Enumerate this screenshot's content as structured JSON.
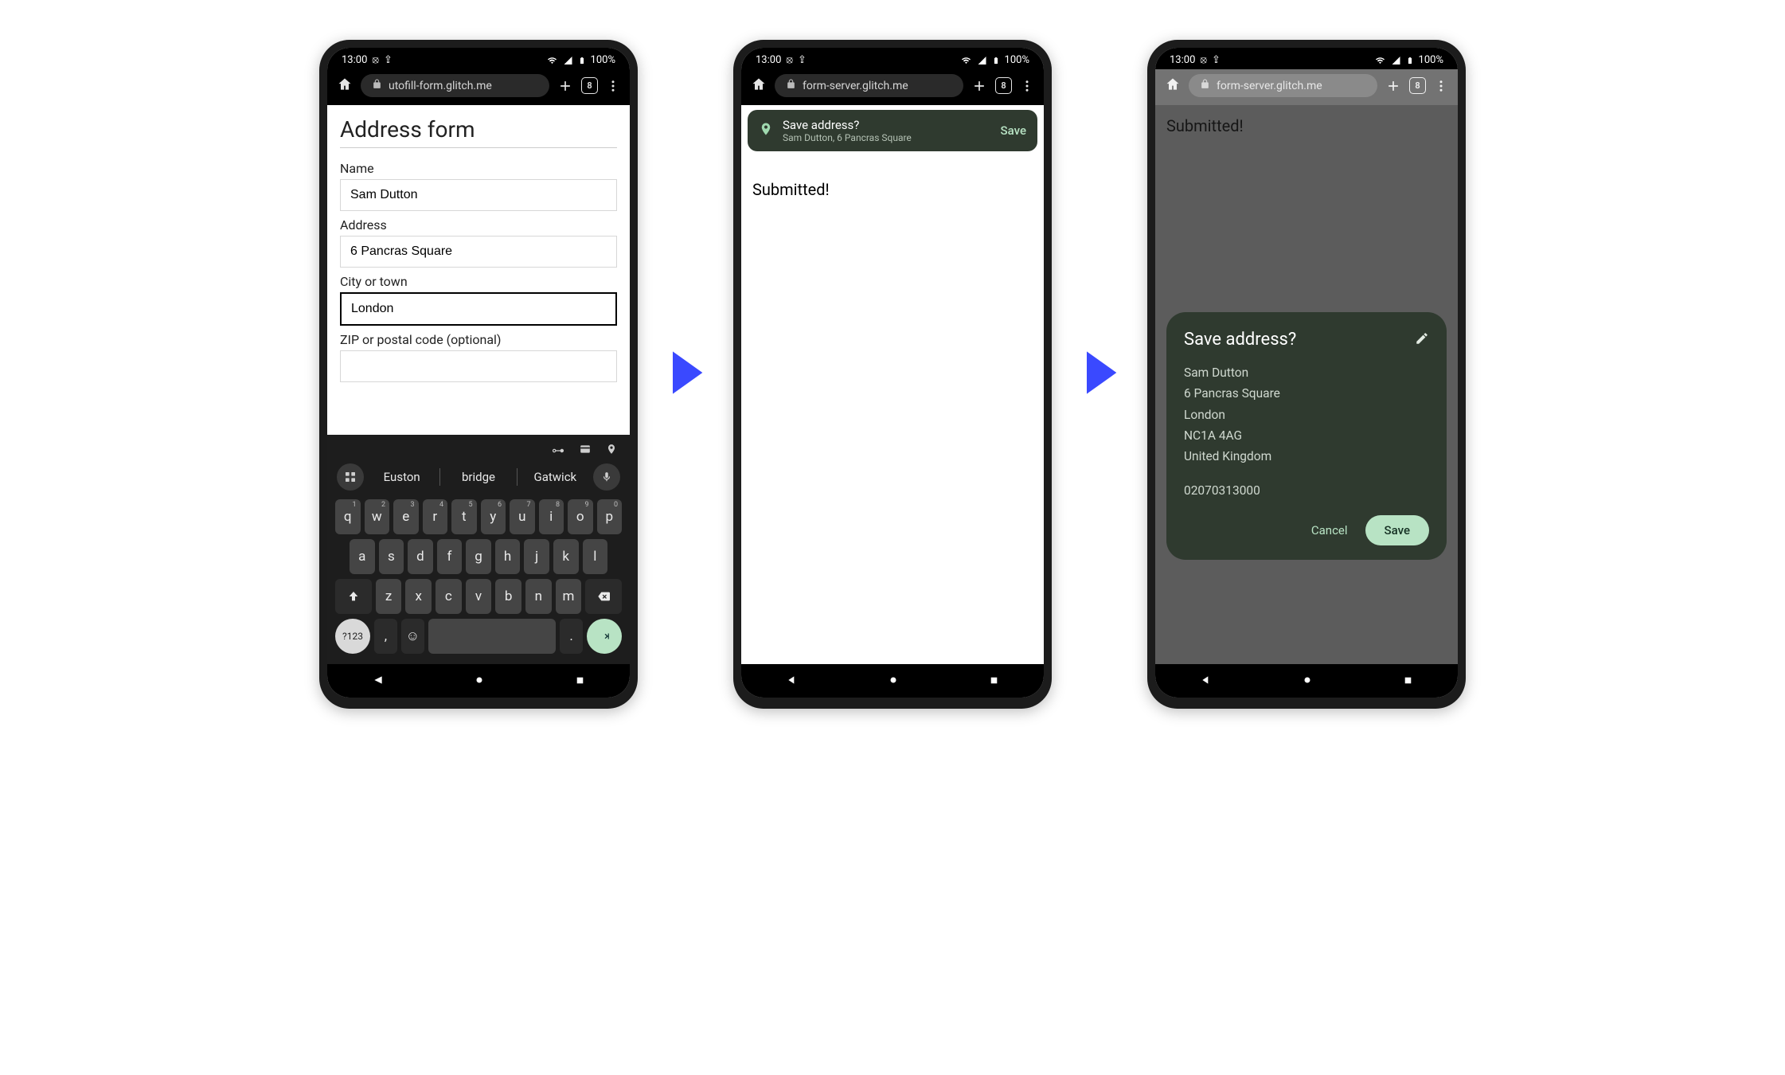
{
  "status": {
    "time": "13:00",
    "battery_text": "100%"
  },
  "omni": {
    "tab_count": "8",
    "urls": {
      "p1": "utofill-form.glitch.me",
      "p2": "form-server.glitch.me",
      "p3": "form-server.glitch.me"
    }
  },
  "form": {
    "heading": "Address form",
    "labels": {
      "name": "Name",
      "address": "Address",
      "city": "City or town",
      "zip": "ZIP or postal code (optional)"
    },
    "values": {
      "name": "Sam Dutton",
      "address": "6 Pancras Square",
      "city": "London"
    }
  },
  "keyboard": {
    "suggestions": [
      "Euston",
      "bridge",
      "Gatwick"
    ],
    "row1": [
      "q",
      "w",
      "e",
      "r",
      "t",
      "y",
      "u",
      "i",
      "o",
      "p"
    ],
    "sup1": [
      "1",
      "2",
      "3",
      "4",
      "5",
      "6",
      "7",
      "8",
      "9",
      "0"
    ],
    "row2": [
      "a",
      "s",
      "d",
      "f",
      "g",
      "h",
      "j",
      "k",
      "l"
    ],
    "row3": [
      "z",
      "x",
      "c",
      "v",
      "b",
      "n",
      "m"
    ],
    "sym": "?123",
    "comma": ",",
    "period": "."
  },
  "snackbar": {
    "title": "Save address?",
    "subtitle": "Sam Dutton, 6 Pancras Square",
    "save": "Save"
  },
  "submitted": "Submitted!",
  "dialog": {
    "title": "Save address?",
    "lines": [
      "Sam Dutton",
      "6 Pancras Square",
      "London",
      "NC1A 4AG",
      "United Kingdom"
    ],
    "phone": "02070313000",
    "cancel": "Cancel",
    "save": "Save"
  }
}
